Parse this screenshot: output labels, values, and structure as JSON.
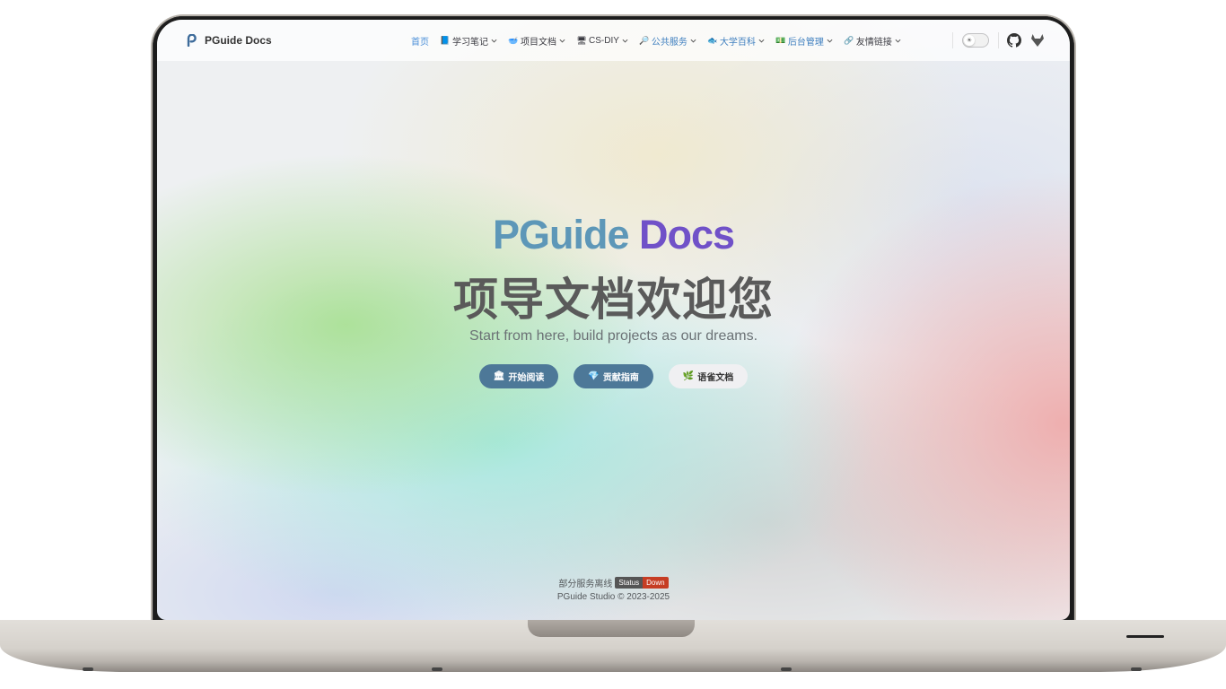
{
  "brand": {
    "name": "PGuide Docs"
  },
  "nav": {
    "items": [
      {
        "label": "首页",
        "icon": "",
        "dropdown": false
      },
      {
        "label": "学习笔记",
        "icon": "📘",
        "dropdown": true
      },
      {
        "label": "项目文档",
        "icon": "🥣",
        "dropdown": true
      },
      {
        "label": "CS-DIY",
        "icon": "🖥",
        "dropdown": true
      },
      {
        "label": "公共服务",
        "icon": "🔎",
        "dropdown": true
      },
      {
        "label": "大学百科",
        "icon": "🐟",
        "dropdown": true
      },
      {
        "label": "后台管理",
        "icon": "💵",
        "dropdown": true
      },
      {
        "label": "友情链接",
        "icon": "🔗",
        "dropdown": true
      }
    ],
    "theme_icon": "☀"
  },
  "hero": {
    "name_part1": "PGuide",
    "name_part2": "Docs",
    "subtitle": "项导文档欢迎您",
    "tagline": "Start from here, build projects as our dreams."
  },
  "actions": [
    {
      "icon": "🏛",
      "label": "开始阅读"
    },
    {
      "icon": "💎",
      "label": "贡献指南"
    },
    {
      "icon": "🌿",
      "label": "语雀文档"
    }
  ],
  "footer": {
    "status_text": "部分服务离线",
    "badge_label": "Status",
    "badge_value": "Down",
    "copyright": "PGuide Studio © 2023-2025"
  }
}
